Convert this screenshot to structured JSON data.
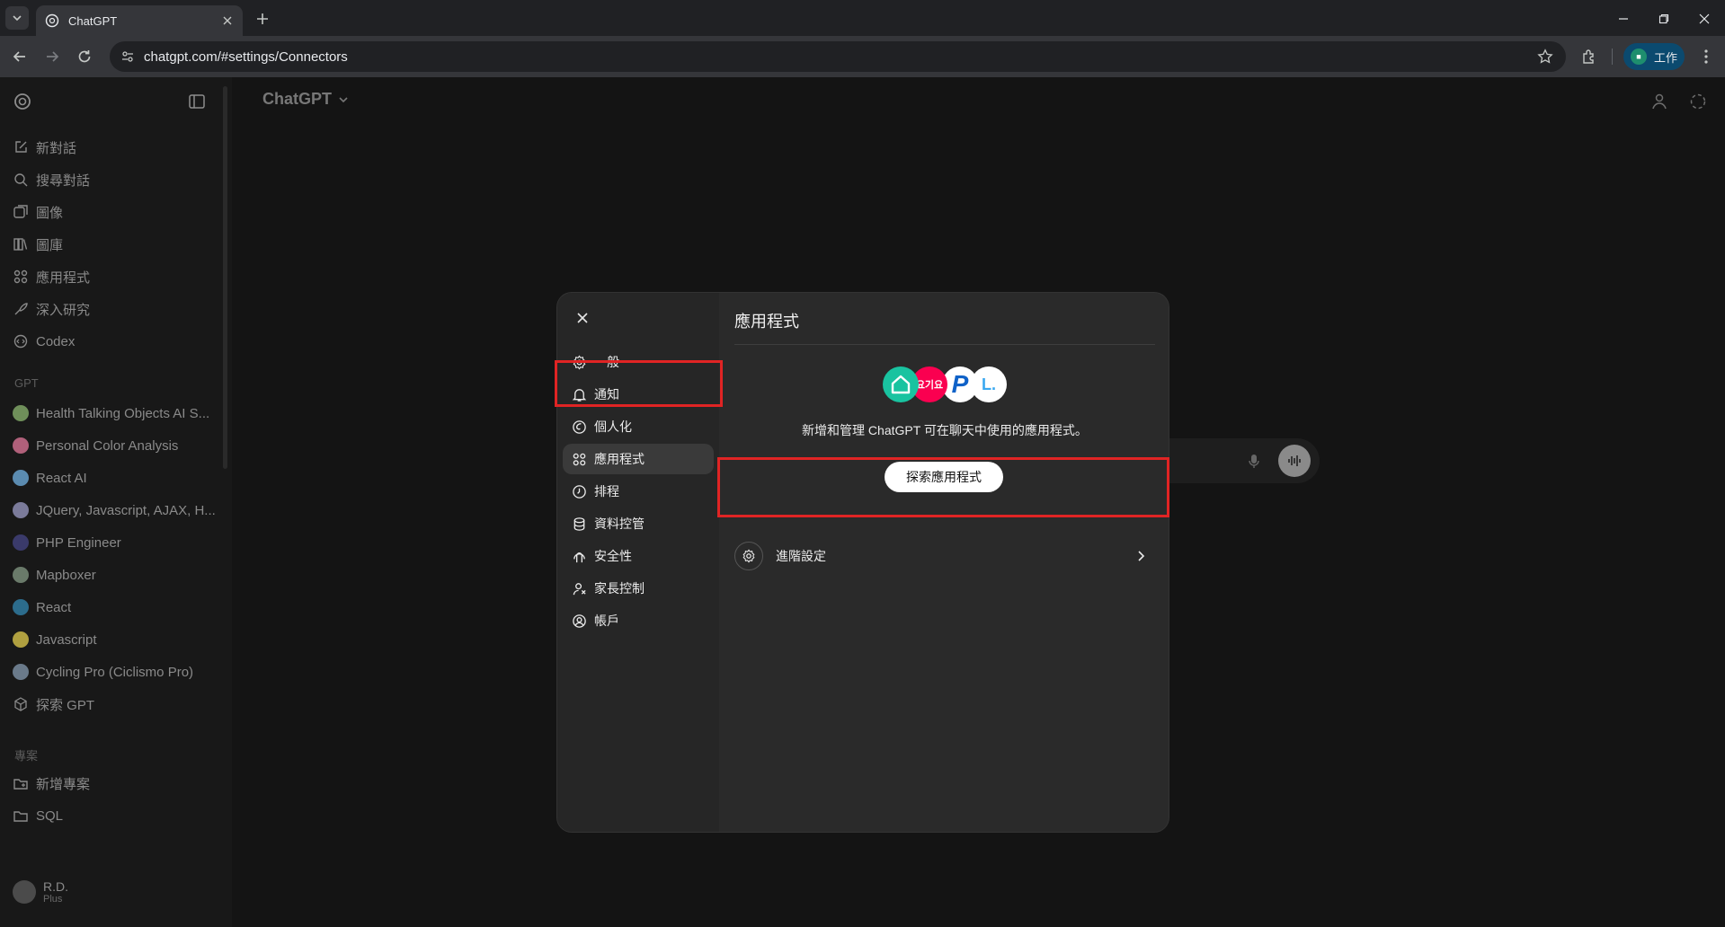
{
  "browser": {
    "tab_title": "ChatGPT",
    "url": "chatgpt.com/#settings/Connectors",
    "profile_label": "工作"
  },
  "app": {
    "model_name": "ChatGPT"
  },
  "sidebar": {
    "nav": [
      {
        "label": "新對話",
        "icon": "new-chat-icon"
      },
      {
        "label": "搜尋對話",
        "icon": "search-icon"
      },
      {
        "label": "圖像",
        "icon": "image-icon"
      },
      {
        "label": "圖庫",
        "icon": "library-icon"
      },
      {
        "label": "應用程式",
        "icon": "apps-icon"
      },
      {
        "label": "深入研究",
        "icon": "deep-research-icon"
      },
      {
        "label": "Codex",
        "icon": "codex-icon"
      }
    ],
    "gpt_section_label": "GPT",
    "gpts": [
      {
        "label": "Health Talking Objects AI S...",
        "color": "#6f8f5a"
      },
      {
        "label": "Personal Color Analysis",
        "color": "#b0607a"
      },
      {
        "label": "React AI",
        "color": "#5b8bb0"
      },
      {
        "label": "JQuery, Javascript, AJAX, H...",
        "color": "#7b7b9a"
      },
      {
        "label": "PHP Engineer",
        "color": "#3a3a6a"
      },
      {
        "label": "Mapboxer",
        "color": "#6a7a6a"
      },
      {
        "label": "React",
        "color": "#2c6c8c"
      },
      {
        "label": "Javascript",
        "color": "#b0a040"
      },
      {
        "label": "Cycling Pro (Ciclismo Pro)",
        "color": "#6a7a8a"
      },
      {
        "label": "探索 GPT",
        "color": ""
      }
    ],
    "projects_section_label": "專案",
    "projects": [
      {
        "label": "新增專案"
      },
      {
        "label": "SQL"
      }
    ],
    "user": {
      "name": "R.D.",
      "plan": "Plus"
    }
  },
  "settings_modal": {
    "nav": [
      {
        "label": "一般",
        "icon": "gear-icon"
      },
      {
        "label": "通知",
        "icon": "bell-icon"
      },
      {
        "label": "個人化",
        "icon": "personalization-icon"
      },
      {
        "label": "應用程式",
        "icon": "apps-icon",
        "active": true
      },
      {
        "label": "排程",
        "icon": "clock-icon"
      },
      {
        "label": "資料控管",
        "icon": "database-icon"
      },
      {
        "label": "安全性",
        "icon": "security-icon"
      },
      {
        "label": "家長控制",
        "icon": "parental-control-icon"
      },
      {
        "label": "帳戶",
        "icon": "account-icon"
      }
    ],
    "title": "應用程式",
    "logos": [
      {
        "text": "",
        "color": "#19c3a0"
      },
      {
        "text": "요기요",
        "color": "#fa0050"
      },
      {
        "text": "P",
        "color": "#ffffff"
      },
      {
        "text": "L.",
        "color": "#ffffff"
      }
    ],
    "description": "新增和管理 ChatGPT 可在聊天中使用的應用程式。",
    "explore_button": "探索應用程式",
    "advanced_settings": "進階設定"
  }
}
